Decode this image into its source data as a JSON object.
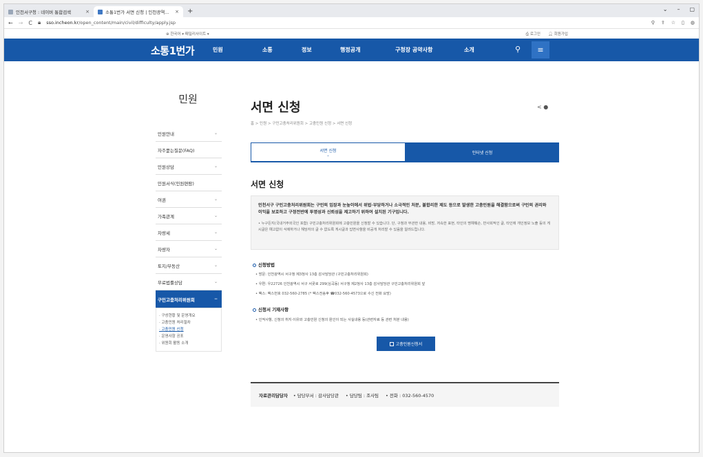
{
  "browser": {
    "tabs": [
      {
        "label": "인천서구청 : 네이버 통합검색"
      },
      {
        "label": "소통1번가 서면 신청 | 인천광역..."
      }
    ],
    "new_tab": "+",
    "window_controls": [
      "⌄",
      "–",
      "▢"
    ],
    "url_host": "sso.incheon.kr",
    "url_path": "/open_content/main/civil/difficulty/apply.jsp",
    "nav_icons": [
      "←",
      "→",
      "C"
    ],
    "right_icons": [
      "⚲",
      "⇪",
      "☆",
      "▯",
      "◍"
    ]
  },
  "util": {
    "lang": "⊕ 한국어  ▾   패밀리사이트  ▾",
    "login": "로그인",
    "join": "회원가입"
  },
  "gnb": {
    "logo": "소통1번가",
    "menu": [
      "민원",
      "소통",
      "정보",
      "행정공개",
      "구청장 공약사항",
      "소개"
    ]
  },
  "sidebar": {
    "title": "민원",
    "items": [
      {
        "label": "민원안내",
        "has_sub": true
      },
      {
        "label": "자주묻는질문(FAQ)",
        "has_sub": false
      },
      {
        "label": "민원상담",
        "has_sub": true
      },
      {
        "label": "민원서식(민원편람)",
        "has_sub": false
      },
      {
        "label": "여권",
        "has_sub": true
      },
      {
        "label": "가족관계",
        "has_sub": true
      },
      {
        "label": "차량세",
        "has_sub": true
      },
      {
        "label": "차량자",
        "has_sub": true
      },
      {
        "label": "토지/부동산",
        "has_sub": true
      },
      {
        "label": "무료법률상담",
        "has_sub": true
      },
      {
        "label": "구민고충처리위원회",
        "has_sub": true,
        "active": true
      }
    ],
    "sub_items": [
      "· 구성현황 및 운영개요",
      "· 고충민원 처리절차",
      "· 고충민원 신청",
      "· 운영사항 공포",
      "· 위원회 활동 소개"
    ],
    "sub_current_index": 2
  },
  "content": {
    "title": "서면 신청",
    "share_icons": "< ●",
    "breadcrumb": "홈 > 민원 > 구민고충처리위원회 > 고충민원 신청 > 서면 신청",
    "tabs": [
      {
        "label": "서면 신청",
        "active": true
      },
      {
        "label": "인터넷 신청",
        "active": false
      }
    ],
    "section_title": "서면 신청",
    "lead": "인천서구 구민고충처리위원회는 구민의 입장과 눈높이에서 위법·부당하거나 소극적인 처분, 불합리한 제도 등으로 발생한 고충민원을 해결함으로써 구민의 권리와 이익을 보호하고 구정전반에 투명성과 신뢰성을 제고하기 위하여 설치된 기구입니다.",
    "note": "• 누구든지(국내거주외국인 포함) 구민고충처리위원회에 고충민원을 신청할 수 있습니다. 단, 구청과 무관한 내용, 비방, 저속한 표현, 타인의 명예훼손, 반사회적인 글, 타인에 개인정보 노출 등의 게시글은 예고없이 삭제하거나 해당자의 글 수 없도록 게시글과 답변사항을 비공개 처리할 수 있음을 알려드립니다.",
    "method_heading": "신청방법",
    "method_lines": [
      "• 방문: 인천광역시 서구청 제3청사 13층 감사담당관 (구민고충처리위원회)",
      "• 우편: 우22726 인천광역시 서구 서곶로 299(심곡동) 서구청 제2청사 13층 감사담당관 구민고충처리위원회 앞",
      "• 팩스: 팩스번호 032-560-2785 (* 팩스전송후 ☎032-560-4573으로 수신 전화 요망)"
    ],
    "form_heading": "신청서 기재사항",
    "form_lines": [
      "• 인적사항, 신청의 취지·이유와 고충민원 신청의 원인이 되는 사실내용 등(관련자료 등 관련 처분 내용)"
    ],
    "download_label": "고충민원신청서",
    "manager": {
      "label": "자료관리담당자",
      "dept": "• 담당부서 : 감사담당관",
      "team": "• 담당팀 : 조사팀",
      "phone": "• 전화 : 032-560-4570"
    }
  },
  "colors": {
    "primary": "#1758a8",
    "bg": "#f3f3f3"
  }
}
